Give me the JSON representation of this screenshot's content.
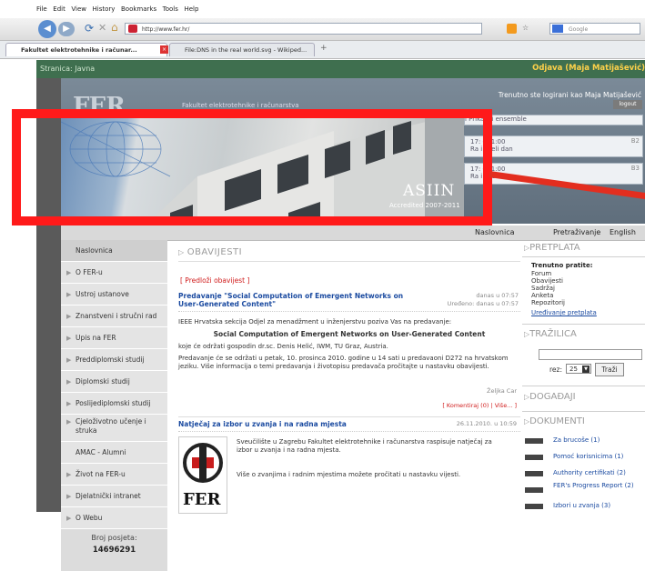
{
  "browser": {
    "menu": [
      "File",
      "Edit",
      "View",
      "History",
      "Bookmarks",
      "Tools",
      "Help"
    ],
    "url": "http://www.fer.hr/",
    "search_placeholder": "Google",
    "tabs": [
      "Fakultet elektrotehnike i računar...",
      "File:DNS in the real world.svg - Wikiped..."
    ]
  },
  "site": {
    "stranica": "Stranica: Javna",
    "logout_link": "Odjava (Maja Matijašević)",
    "logo": "FER",
    "faculty_text": "Fakultet elektrotehnike i računarstva",
    "logged_in_text": "Trenutno ste logirani kao Maja Matijašević",
    "logout_button": "logout",
    "events": [
      {
        "time": "17:  - 21:00",
        "desc": "Ra  i cijeli dan",
        "num": "B2"
      },
      {
        "time": "17:  - 21:00",
        "desc": "Ra  i cijeli dan",
        "num": "B3"
      }
    ],
    "event_top": "  i Prikazni ensemble",
    "photo_badge": "ASIIN",
    "photo_caption": "Accredited 2007-2011",
    "topnav": {
      "home": "Naslovnica",
      "search": "Pretraživanje",
      "english": "English"
    },
    "leftnav": [
      "Naslovnica",
      "O FER-u",
      "Ustroj ustanove",
      "Znanstveni i stručni rad",
      "Upis na FER",
      "Preddiplomski studij",
      "Diplomski studij",
      "Poslijediplomski studij",
      "Cjeloživotno učenje i struka",
      "AMAC - Alumni",
      "Život na FER-u",
      "Djelatnički intranet",
      "O Webu"
    ],
    "visitors_label": "Broj posjeta:",
    "visitors_count": "14696291"
  },
  "main": {
    "heading": "OBAVIJESTI",
    "submit": "[ Predloži obavijest ]",
    "n1": {
      "title": "Predavanje \"Social Computation of Emergent Networks on User-Generated Content\"",
      "date": "danas u 07:57",
      "edited": "Uređeno: danas u 07:57",
      "p1": "IEEE Hrvatska sekcija Odjel za menadžment u inženjerstvu poziva Vas na predavanje:",
      "title_center": "Social Computation of Emergent Networks on User-Generated Content",
      "p2": "koje će održati gospodin dr.sc. Denis Helić, IWM, TU Graz, Austria.",
      "p3": "Predavanje će se održati u petak, 10. prosinca 2010. godine u 14 sati u predavaoni D272 na hrvatskom jeziku. Više informacija o temi predavanja i životopisu predavača pročitajte u nastavku obavijesti.",
      "author": "Željka Car",
      "links": "[ Komentiraj (0) | Više... ]"
    },
    "n2": {
      "title": "Natječaj za izbor u zvanja i na radna mjesta",
      "date": "26.11.2010. u 10:59",
      "p1": "Sveučilište u Zagrebu Fakultet elektrotehnike i računarstva raspisuje natječaj za izbor u zvanja i na radna mjesta.",
      "p2": "Više o zvanjima i radnim mjestima možete pročitati u nastavku vijesti.",
      "logo": "FER"
    }
  },
  "right": {
    "pretplata": "PRETPLATA",
    "follow_label": "Trenutno pratite:",
    "follow": [
      "Forum",
      "Obavijesti",
      "Sadržaj",
      "Anketa",
      "Repozitorij"
    ],
    "edit_sub": "Uređivanje pretplata",
    "trazilica": "TRAŽILICA",
    "rez_label": "rez:",
    "rez_value": "25",
    "search_btn": "Traži",
    "dogadaji": "DOGAĐAJI",
    "dokumenti": "DOKUMENTI",
    "docs": [
      "Za brucoše (1)",
      "Pomoć korisnicima (1)",
      "Authority certifikati (2)",
      "FER's Progress Report (2)",
      "Izbori u zvanja (3)"
    ]
  }
}
